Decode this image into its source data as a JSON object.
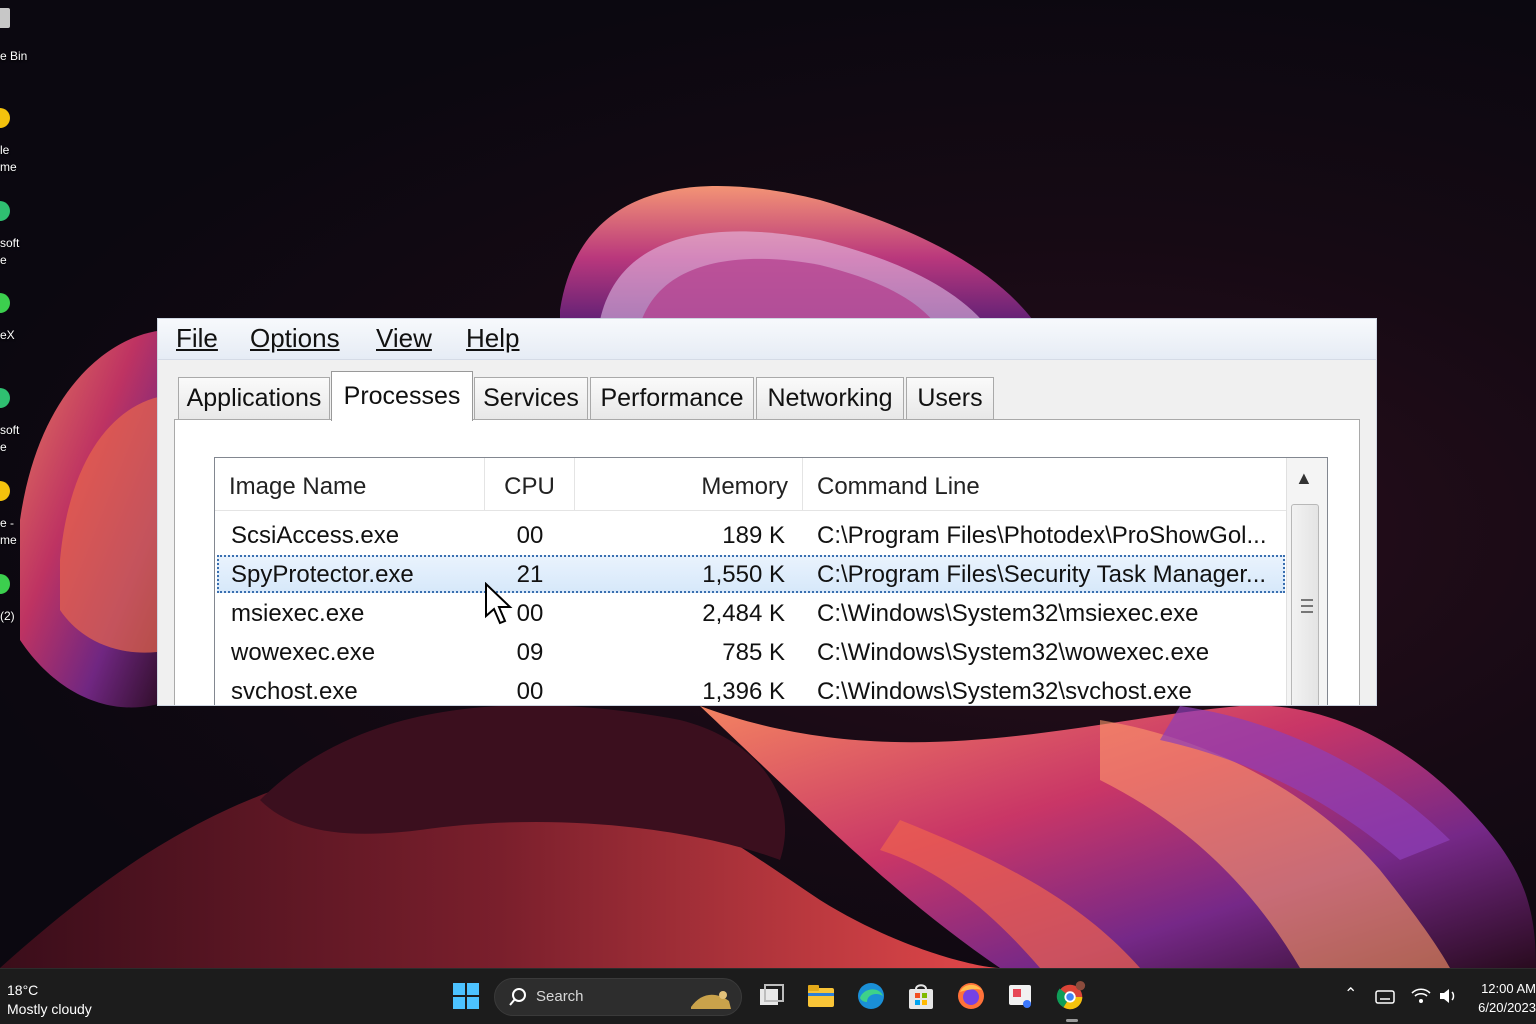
{
  "desktop": {
    "icons": [
      {
        "label": "e Bin",
        "icon": "recycle-bin-icon",
        "color": "#c7c7c7"
      },
      {
        "label": "le\nme",
        "icon": "chrome-icon",
        "color": "#f4c20d"
      },
      {
        "label": "soft\ne",
        "icon": "edge-icon",
        "color": "#2fbf71"
      },
      {
        "label": "eX",
        "icon": "app-icon",
        "color": "#3ccf4e"
      },
      {
        "label": "soft\ne",
        "icon": "edge-icon",
        "color": "#2fbf71"
      },
      {
        "label": "e -\nme",
        "icon": "chrome-profile-icon",
        "color": "#f4c20d"
      },
      {
        "label": "(2)",
        "icon": "app-icon",
        "color": "#3ccf4e"
      }
    ]
  },
  "task_manager": {
    "menu": [
      "File",
      "Options",
      "View",
      "Help"
    ],
    "tabs": [
      "Applications",
      "Processes",
      "Services",
      "Performance",
      "Networking",
      "Users"
    ],
    "active_tab": "Processes",
    "columns": [
      "Image Name",
      "CPU",
      "Memory",
      "Command Line"
    ],
    "rows": [
      {
        "image": "ScsiAccess.exe",
        "cpu": "00",
        "memory": "189 K",
        "cmd": "C:\\Program Files\\Photodex\\ProShowGol..."
      },
      {
        "image": "SpyProtector.exe",
        "cpu": "21",
        "memory": "1,550 K",
        "cmd": "C:\\Program Files\\Security Task Manager..."
      },
      {
        "image": "msiexec.exe",
        "cpu": "00",
        "memory": "2,484 K",
        "cmd": "C:\\Windows\\System32\\msiexec.exe"
      },
      {
        "image": "wowexec.exe",
        "cpu": "09",
        "memory": "785 K",
        "cmd": "C:\\Windows\\System32\\wowexec.exe"
      },
      {
        "image": "svchost.exe",
        "cpu": "00",
        "memory": "1,396 K",
        "cmd": "C:\\Windows\\System32\\svchost.exe"
      }
    ],
    "selected_row": 1
  },
  "taskbar": {
    "weather": {
      "temp": "18°C",
      "condition": "Mostly cloudy"
    },
    "search_placeholder": "Search",
    "apps": [
      "start-icon",
      "task-view-icon",
      "file-explorer-icon",
      "edge-icon",
      "store-icon",
      "firefox-icon",
      "snipping-tool-icon",
      "chrome-icon"
    ],
    "clock": {
      "time": "12:00 AM",
      "date": "6/20/2023"
    }
  }
}
